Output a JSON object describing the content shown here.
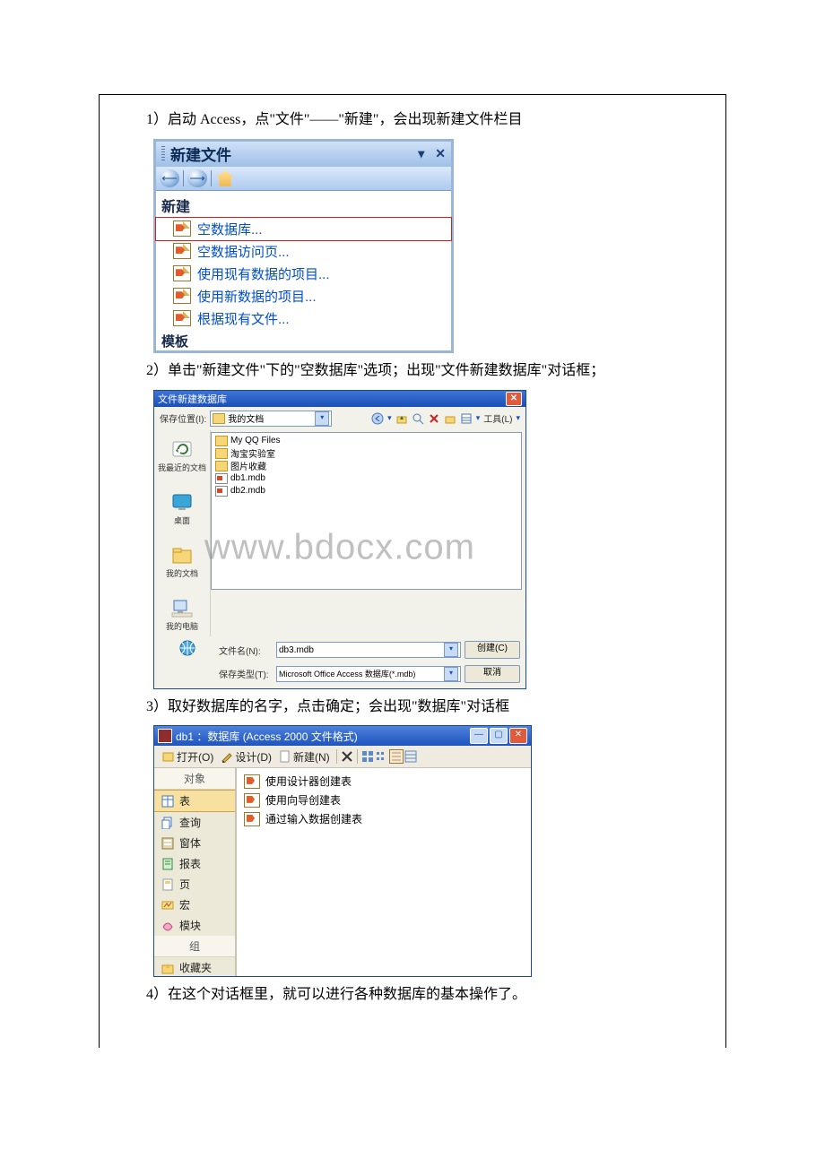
{
  "steps": {
    "s1": "1）启动 Access，点\"文件\"——\"新建\"，会出现新建文件栏目",
    "s2": "2）单击\"新建文件\"下的\"空数据库\"选项；出现\"文件新建数据库\"对话框；",
    "s3": "3）取好数据库的名字，点击确定；会出现\"数据库\"对话框",
    "s4": "4）在这个对话框里，就可以进行各种数据库的基本操作了。"
  },
  "taskpane": {
    "title": "新建文件",
    "section": "新建",
    "items": [
      "空数据库...",
      "空数据访问页...",
      "使用现有数据的项目...",
      "使用新数据的项目...",
      "根据现有文件..."
    ],
    "partial": "模板"
  },
  "save_dialog": {
    "title": "文件新建数据库",
    "location_label": "保存位置(I):",
    "location_value": "我的文档",
    "tools_label": "工具(L)",
    "places": [
      "我最近的文档",
      "桌面",
      "我的文档",
      "我的电脑"
    ],
    "files": {
      "folders": [
        "My QQ Files",
        "淘宝实验室",
        "图片收藏"
      ],
      "mdbs": [
        "db1.mdb",
        "db2.mdb"
      ]
    },
    "filename_label": "文件名(N):",
    "filename_value": "db3.mdb",
    "type_label": "保存类型(T):",
    "type_value": "Microsoft Office Access 数据库(*.mdb)",
    "btn_create": "创建(C)",
    "btn_cancel": "取消",
    "watermark": "www.bdocx.com"
  },
  "dbwin": {
    "title": "db1 ：数据库  (Access 2000 文件格式)",
    "toolbar": {
      "open": "打开(O)",
      "design": "设计(D)",
      "new": "新建(N)"
    },
    "sidebar": {
      "head_objects": "对象",
      "items": [
        "表",
        "查询",
        "窗体",
        "报表",
        "页",
        "宏",
        "模块"
      ],
      "head_groups": "组",
      "fav": "收藏夹"
    },
    "main_items": [
      "使用设计器创建表",
      "使用向导创建表",
      "通过输入数据创建表"
    ]
  }
}
